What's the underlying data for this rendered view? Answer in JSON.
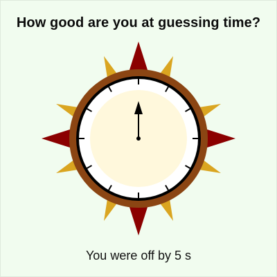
{
  "game": {
    "title": "How good are you at guessing time?",
    "result_text": "You were off by 5 s"
  },
  "dial": {
    "tick_count": 12,
    "hand_value": 0,
    "colors": {
      "page_bg": "#f1fcef",
      "outer_ring": "#8b4513",
      "bezel": "#000000",
      "face_outer": "#ffffff",
      "face_inner": "#fff8dc",
      "cardinal_spike": "#8b0000",
      "diagonal_spike": "#daa520",
      "hand": "#000000"
    }
  }
}
